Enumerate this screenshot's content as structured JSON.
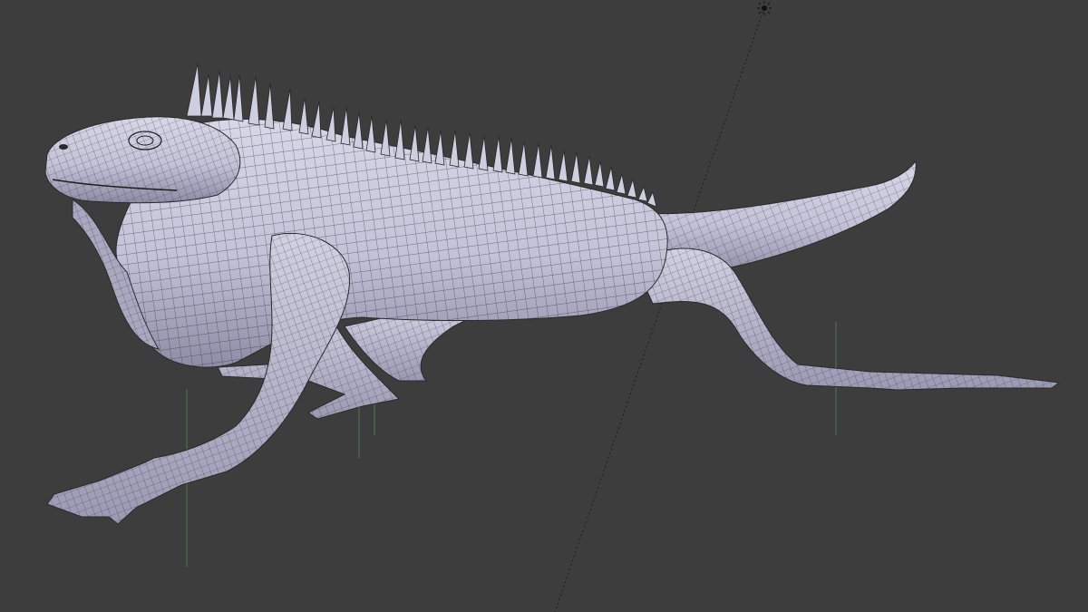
{
  "viewport": {
    "background": "#3d3d3d",
    "shading": "solid-wireframe-overlay",
    "object": "iguana-mesh",
    "mesh_color": "#c9c8dc",
    "mesh_shadow_color": "#8f8ea8",
    "wire_color": "#2a2a2a",
    "light_icon": "sun-lamp-icon",
    "object_origin_lines_color": "#5c8a5c",
    "light_direction_line_color": "#1a1a1a"
  }
}
